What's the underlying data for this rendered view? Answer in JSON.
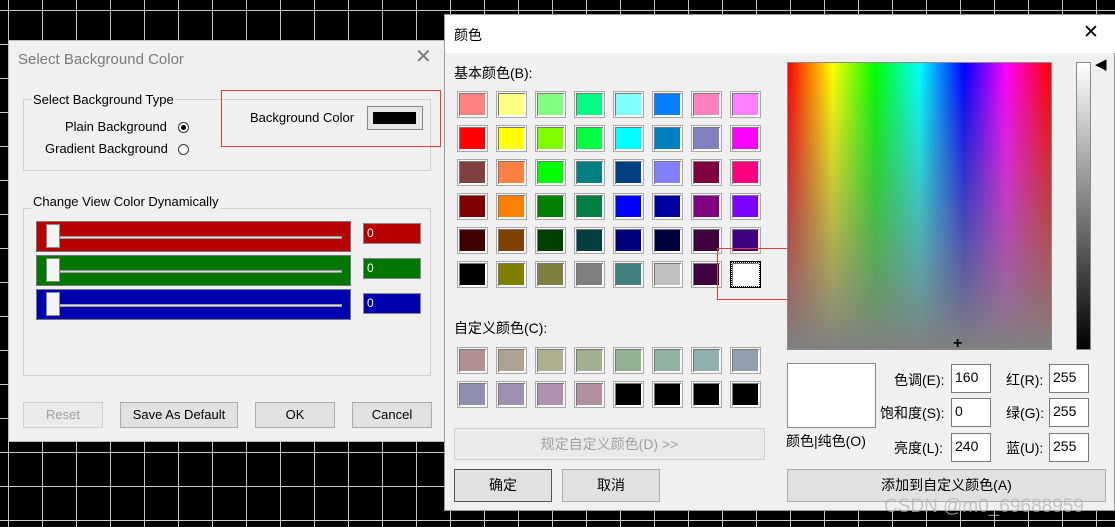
{
  "bg_dialog": {
    "title": "Select Background Color",
    "type_group": {
      "legend": "Select Background Type",
      "plain_label": "Plain Background",
      "gradient_label": "Gradient Background",
      "bg_color_label": "Background Color",
      "selected": "plain"
    },
    "dynamic_group": {
      "legend": "Change View  Color Dynamically",
      "sliders": [
        {
          "channel": "red",
          "value": "0",
          "color": "#b80000"
        },
        {
          "channel": "green",
          "value": "0",
          "color": "#007800"
        },
        {
          "channel": "blue",
          "value": "0",
          "color": "#0000b0"
        }
      ]
    },
    "buttons": {
      "reset": "Reset",
      "save_default": "Save As Default",
      "ok": "OK",
      "cancel": "Cancel"
    }
  },
  "color_dialog": {
    "title": "颜色",
    "basic_label": "基本颜色(B):",
    "custom_label": "自定义颜色(C):",
    "define_custom_button": "规定自定义颜色(D) >>",
    "ok": "确定",
    "cancel": "取消",
    "add_custom_button": "添加到自定义颜色(A)",
    "color_solid_label": "颜色|纯色(O)",
    "fields": {
      "hue_label": "色调(E):",
      "hue": "160",
      "sat_label": "饱和度(S):",
      "sat": "0",
      "lum_label": "亮度(L):",
      "lum": "240",
      "red_label": "红(R):",
      "red": "255",
      "green_label": "绿(G):",
      "green": "255",
      "blue_label": "蓝(U):",
      "blue": "255"
    },
    "basic_colors": [
      "#ff8080",
      "#ffff80",
      "#80ff80",
      "#00ff80",
      "#80ffff",
      "#0080ff",
      "#ff80c0",
      "#ff80ff",
      "#ff0000",
      "#ffff00",
      "#80ff00",
      "#00ff40",
      "#00ffff",
      "#0080c0",
      "#8080c0",
      "#ff00ff",
      "#804040",
      "#ff8040",
      "#00ff00",
      "#008080",
      "#004080",
      "#8080ff",
      "#800040",
      "#ff0080",
      "#800000",
      "#ff8000",
      "#008000",
      "#008040",
      "#0000ff",
      "#0000a0",
      "#800080",
      "#8000ff",
      "#400000",
      "#804000",
      "#004000",
      "#004040",
      "#000080",
      "#000040",
      "#400040",
      "#400080",
      "#000000",
      "#808000",
      "#808040",
      "#808080",
      "#408080",
      "#c0c0c0",
      "#400040",
      "#ffffff"
    ],
    "custom_colors": [
      "#b09090",
      "#b0a090",
      "#b0b090",
      "#a0b090",
      "#90b090",
      "#90b0a0",
      "#90b0b0",
      "#90a0b0",
      "#9090b0",
      "#a090b0",
      "#b090b0",
      "#b090a0",
      "#000000",
      "#000000",
      "#000000",
      "#000000"
    ],
    "current_color": "#ffffff"
  },
  "watermark": "CSDN @m0_69688959"
}
